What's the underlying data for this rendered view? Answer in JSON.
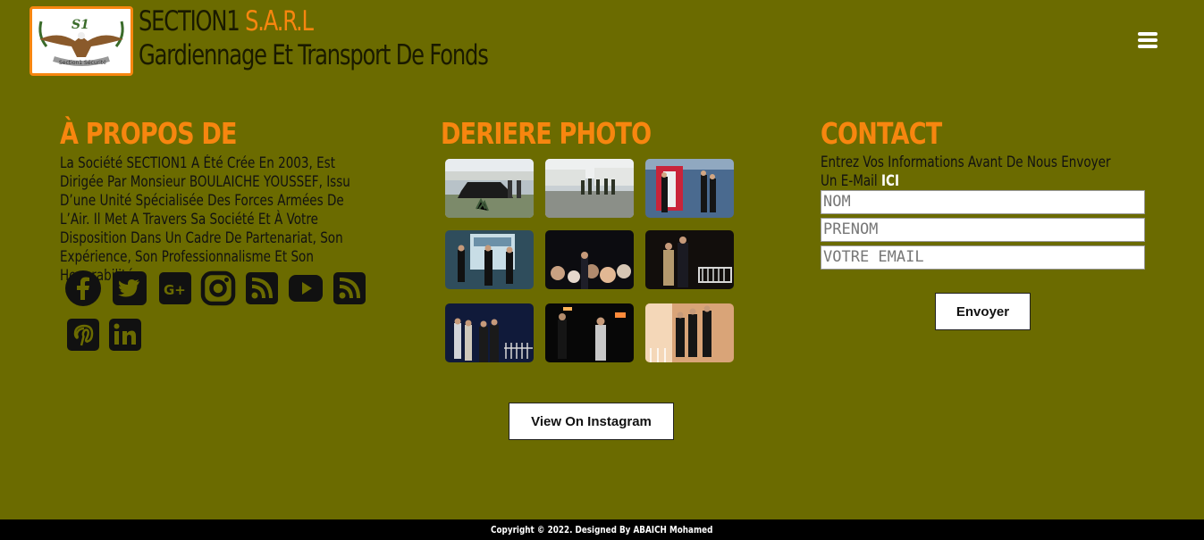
{
  "header": {
    "brand_name": "SECTION1",
    "brand_suffix": "S.A.R.L",
    "tagline": "Gardiennage Et Transport De Fonds",
    "logo_text": "S1",
    "logo_sub": "Section1 Sécurité",
    "menu_icon": "hamburger-icon"
  },
  "about": {
    "title": "À PROPOS DE",
    "text": "La Société SECTION1 A Été Crée En 2003, Est Dirigée Par Monsieur BOULAICHE YOUSSEF, Issu D’une Unité Spécialisée Des Forces Armées De L’Air. Il Met A Travers Sa Société Et À Votre Disposition Dans Un Cadre De Partenariat, Son Expérience, Son Professionnalisme Et Son Honorabilité.",
    "social_icons": [
      "facebook-icon",
      "twitter-icon",
      "google-plus-icon",
      "instagram-icon",
      "rss-icon",
      "youtube-icon",
      "rss-icon",
      "pinterest-icon",
      "linkedin-icon"
    ]
  },
  "gallery": {
    "title": "DERIERE PHOTO",
    "button_label": "View On Instagram"
  },
  "contact": {
    "title": "CONTACT",
    "text": "Entrez Vos Informations Avant De Nous Envoyer Un E-Mail",
    "link_text": "ICI",
    "name_placeholder": "NOM",
    "firstname_placeholder": "PRENOM",
    "email_placeholder": "VOTRE EMAIL",
    "send_label": "Envoyer"
  },
  "footer": {
    "copyright": "Copyright © 2022. Designed By ABAICH Mohamed"
  },
  "colors": {
    "background": "#6b6b00",
    "accent": "#f7860f",
    "footer": "#000000"
  }
}
